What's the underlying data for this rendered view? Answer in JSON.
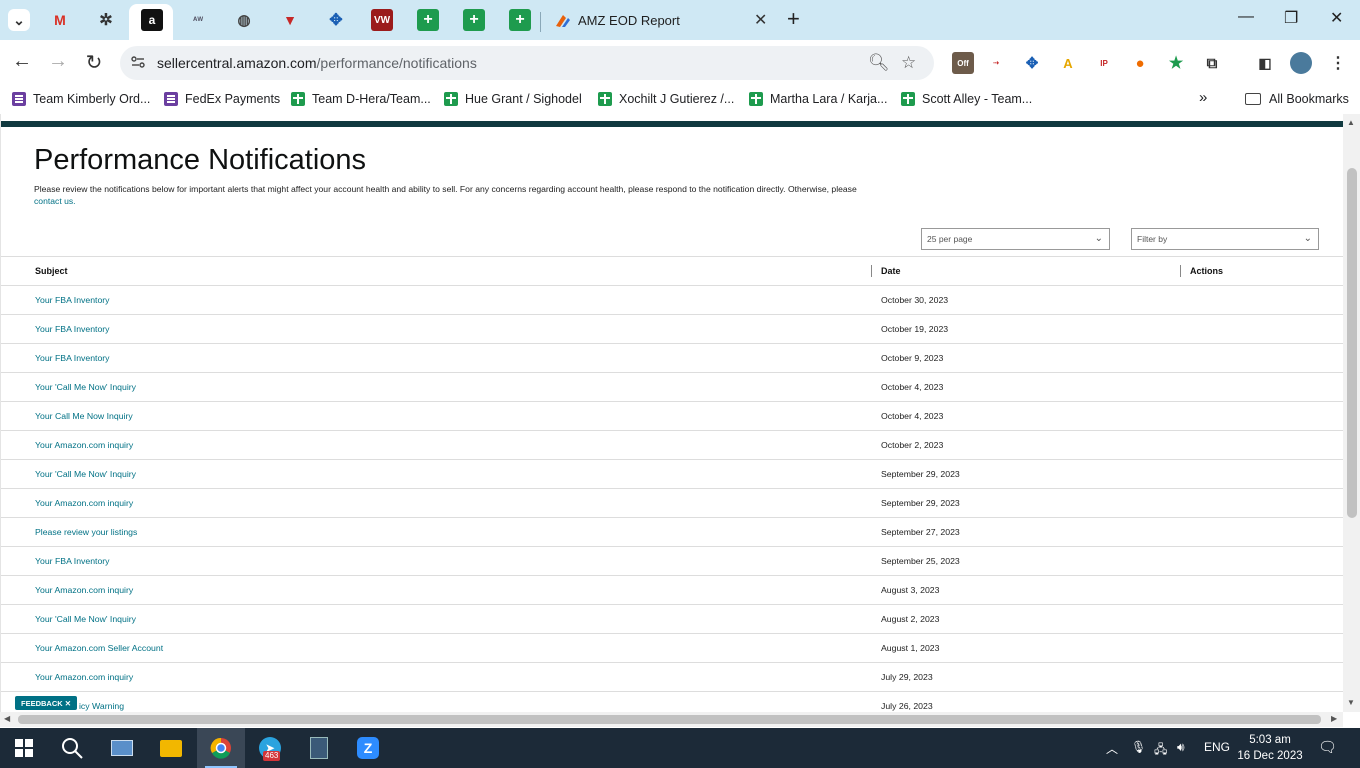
{
  "browser": {
    "tabs": [
      {
        "name": "tab-dropdown",
        "glyph": "⌄"
      },
      {
        "name": "tab-gmail",
        "glyph": "M"
      },
      {
        "name": "tab-chatgpt",
        "glyph": "✲"
      },
      {
        "name": "tab-amazon",
        "glyph": "a"
      },
      {
        "name": "tab-aw",
        "glyph": "ᴬᵂ"
      },
      {
        "name": "tab-globe",
        "glyph": "◍"
      },
      {
        "name": "tab-v",
        "glyph": "▼"
      },
      {
        "name": "tab-blue",
        "glyph": "✥"
      },
      {
        "name": "tab-vw",
        "glyph": "VW"
      },
      {
        "name": "tab-sheets-1",
        "glyph": "+"
      },
      {
        "name": "tab-sheets-2",
        "glyph": "+"
      },
      {
        "name": "tab-sheets-3",
        "glyph": "+"
      }
    ],
    "active_tab_title": "AMZ EOD Report",
    "url_host": "sellercentral.amazon.com",
    "url_path": "/performance/notifications",
    "bookmarks": [
      {
        "label": "Team Kimberly Ord...",
        "icon": "purple"
      },
      {
        "label": "FedEx Payments",
        "icon": "purple"
      },
      {
        "label": "Team D-Hera/Team...",
        "icon": "green"
      },
      {
        "label": "Hue Grant / Sighodel",
        "icon": "green"
      },
      {
        "label": "Xochilt J Gutierez /...",
        "icon": "green"
      },
      {
        "label": "Martha Lara / Karja...",
        "icon": "green"
      },
      {
        "label": "Scott Alley - Team...",
        "icon": "green"
      }
    ],
    "all_bookmarks": "All Bookmarks",
    "ext_off_label": "Off"
  },
  "page": {
    "title": "Performance Notifications",
    "intro": "Please review the notifications below for important alerts that might affect your account health and ability to sell. For any concerns regarding account health, please respond to the notification directly. Otherwise, please",
    "contact_link": "contact us.",
    "per_page": "25 per page",
    "filter_placeholder": "Filter by",
    "columns": {
      "subject": "Subject",
      "date": "Date",
      "actions": "Actions"
    },
    "rows": [
      {
        "subject": "Your FBA Inventory",
        "date": "October 30, 2023"
      },
      {
        "subject": "Your FBA Inventory",
        "date": "October 19, 2023"
      },
      {
        "subject": "Your FBA Inventory",
        "date": "October 9, 2023"
      },
      {
        "subject": "Your 'Call Me Now' Inquiry",
        "date": "October 4, 2023"
      },
      {
        "subject": "Your Call Me Now Inquiry",
        "date": "October 4, 2023"
      },
      {
        "subject": "Your Amazon.com inquiry",
        "date": "October 2, 2023"
      },
      {
        "subject": "Your 'Call Me Now' Inquiry",
        "date": "September 29, 2023"
      },
      {
        "subject": "Your Amazon.com inquiry",
        "date": "September 29, 2023"
      },
      {
        "subject": "Please review your listings",
        "date": "September 27, 2023"
      },
      {
        "subject": "Your FBA Inventory",
        "date": "September 25, 2023"
      },
      {
        "subject": "Your Amazon.com inquiry",
        "date": "August 3, 2023"
      },
      {
        "subject": "Your 'Call Me Now' Inquiry",
        "date": "August 2, 2023"
      },
      {
        "subject": "Your Amazon.com Seller Account",
        "date": "August 1, 2023"
      },
      {
        "subject": "Your Amazon.com inquiry",
        "date": "July 29, 2023"
      },
      {
        "subject": "icy Warning",
        "date": "July 26, 2023"
      }
    ],
    "feedback_label": "FEEDBACK ✕"
  },
  "taskbar": {
    "telegram_badge": "463",
    "lang": "ENG",
    "time": "5:03 am",
    "date": "16 Dec 2023"
  },
  "colors": {
    "accent": "#007185",
    "header_bar": "#10393f",
    "tabstrip": "#cfe8f4"
  }
}
